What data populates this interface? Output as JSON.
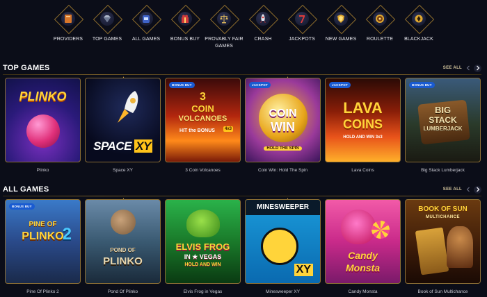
{
  "categories": [
    {
      "label": "PROVIDERS",
      "icon": "provider-book-icon"
    },
    {
      "label": "TOP GAMES",
      "icon": "diamond-icon"
    },
    {
      "label": "ALL GAMES",
      "icon": "slot-machine-icon"
    },
    {
      "label": "BONUS BUY",
      "icon": "gift-icon"
    },
    {
      "label": "PROVABLY FAIR GAMES",
      "icon": "scales-icon"
    },
    {
      "label": "CRASH",
      "icon": "rocket-icon"
    },
    {
      "label": "JACKPOTS",
      "icon": "seven-icon"
    },
    {
      "label": "NEW GAMES",
      "icon": "new-shield-icon"
    },
    {
      "label": "ROULETTE",
      "icon": "roulette-icon"
    },
    {
      "label": "BLACKJACK",
      "icon": "cards-icon"
    }
  ],
  "sections": {
    "top_games": {
      "title": "TOP GAMES",
      "see_all": "SEE ALL",
      "games": [
        {
          "name": "Plinko",
          "badge": "",
          "art": [
            "PLINKO"
          ]
        },
        {
          "name": "Space XY",
          "badge": "",
          "art": [
            "SPACE",
            "XY"
          ]
        },
        {
          "name": "3 Coin Volcanoes",
          "badge": "BONUS BUY",
          "art": [
            "3",
            "COIN",
            "VOLCANOES",
            "HIT the BONUS",
            "4x3"
          ]
        },
        {
          "name": "Coin Win: Hold The Spin",
          "badge": "JACKPOT",
          "art": [
            "COIN",
            "WIN",
            "HOLD THE SPIN"
          ]
        },
        {
          "name": "Lava Coins",
          "badge": "JACKPOT",
          "art": [
            "LAVA",
            "COINS",
            "HOLD AND WIN 3x3"
          ]
        },
        {
          "name": "Big Stack Lumberjack",
          "badge": "BONUS BUY",
          "art": [
            "BIG",
            "STACK",
            "LUMBERJACK"
          ]
        }
      ]
    },
    "all_games": {
      "title": "ALL GAMES",
      "see_all": "SEE ALL",
      "games": [
        {
          "name": "Pine Of Plinko 2",
          "badge": "BONUS BUY",
          "art": [
            "PINE OF",
            "PLINKO",
            "2"
          ]
        },
        {
          "name": "Pond Of Plinko",
          "badge": "",
          "art": [
            "POND OF",
            "PLINKO"
          ]
        },
        {
          "name": "Elvis Frog in Vegas",
          "badge": "",
          "art": [
            "ELVIS FROG",
            "IN ★ VEGAS",
            "HOLD AND WIN"
          ]
        },
        {
          "name": "Minesweeper XY",
          "badge": "",
          "art": [
            "MINESWEEPER",
            "XY"
          ]
        },
        {
          "name": "Candy Monsta",
          "badge": "",
          "art": [
            "Candy",
            "Monsta"
          ]
        },
        {
          "name": "Book of Sun Multichance",
          "badge": "",
          "art": [
            "BOOK OF SUN",
            "MULTICHANCE"
          ]
        }
      ]
    }
  },
  "colors": {
    "background": "#0b0d18",
    "gold": "#8a6d34",
    "badge_blue": "#1a5bd1"
  }
}
